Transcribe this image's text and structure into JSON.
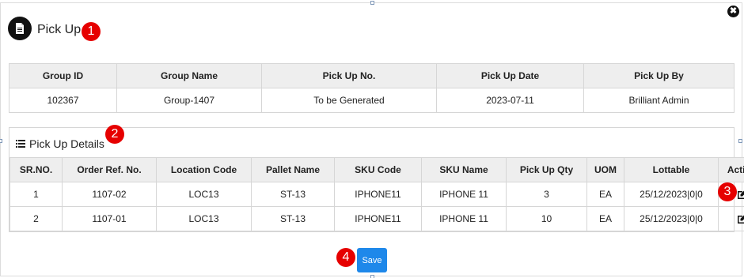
{
  "header": {
    "title": "Pick Up",
    "close_glyph": "✖"
  },
  "markers": [
    "1",
    "2",
    "3",
    "4"
  ],
  "group_table": {
    "columns": [
      "Group ID",
      "Group Name",
      "Pick Up No.",
      "Pick Up Date",
      "Pick Up By"
    ],
    "row": [
      "102367",
      "Group-1407",
      "To be Generated",
      "2023-07-11",
      "Brilliant Admin"
    ]
  },
  "details": {
    "title": "Pick Up Details",
    "columns": [
      "SR.NO.",
      "Order Ref. No.",
      "Location Code",
      "Pallet Name",
      "SKU Code",
      "SKU Name",
      "Pick Up Qty",
      "UOM",
      "Lottable",
      "Action"
    ],
    "rows": [
      [
        "1",
        "1107-02",
        "LOC13",
        "ST-13",
        "IPHONE11",
        "IPHONE 11",
        "3",
        "EA",
        "25/12/2023|0|0"
      ],
      [
        "2",
        "1107-01",
        "LOC13",
        "ST-13",
        "IPHONE11",
        "IPHONE 11",
        "10",
        "EA",
        "25/12/2023|0|0"
      ]
    ]
  },
  "footer": {
    "save_label": "Save"
  },
  "icons": {
    "title": "document-icon",
    "details": "list-icon",
    "row_action": "edit-icon",
    "close": "close-icon"
  },
  "colors": {
    "badge": "#e60000",
    "save_button": "#1e88ea",
    "header_bg": "#eeeeee"
  }
}
